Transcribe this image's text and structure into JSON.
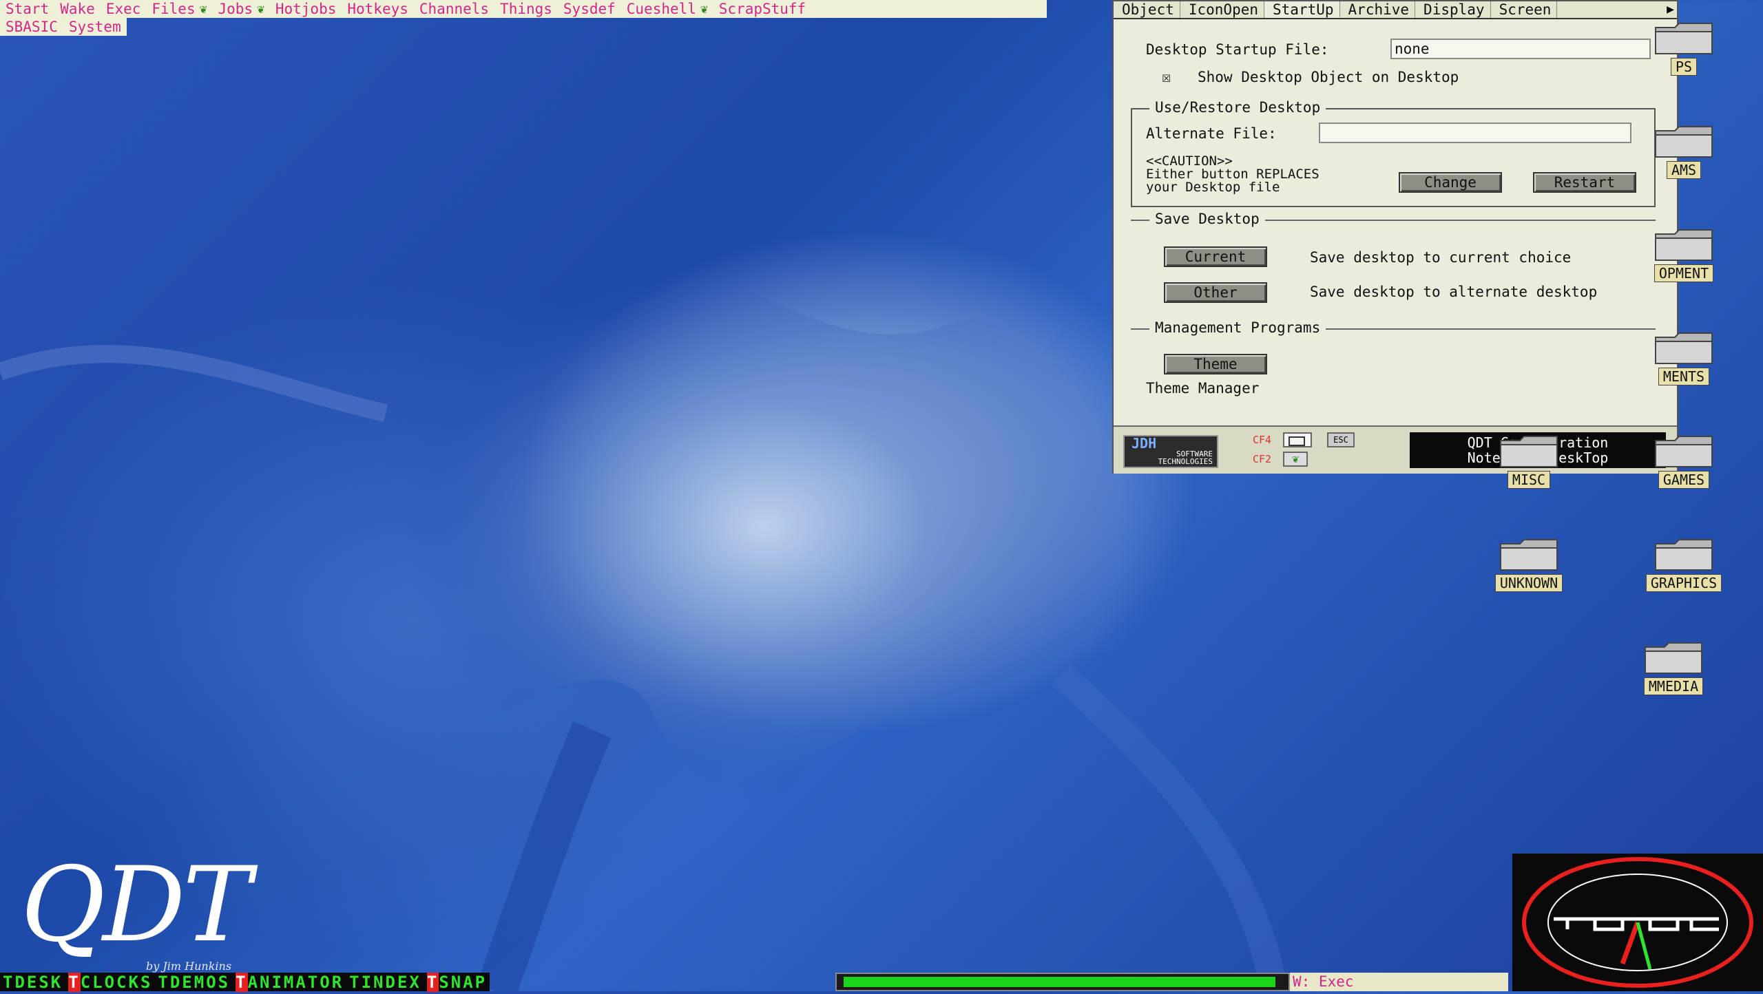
{
  "menu": {
    "row1": [
      {
        "label": "Start",
        "leaf": false
      },
      {
        "label": "Wake",
        "leaf": false
      },
      {
        "label": "Exec",
        "leaf": false
      },
      {
        "label": "Files",
        "leaf": true
      },
      {
        "label": "Jobs",
        "leaf": true
      },
      {
        "label": "Hotjobs",
        "leaf": false
      },
      {
        "label": "Hotkeys",
        "leaf": false
      },
      {
        "label": "Channels",
        "leaf": false
      },
      {
        "label": "Things",
        "leaf": false
      },
      {
        "label": "Sysdef",
        "leaf": false
      },
      {
        "label": "Cueshell",
        "leaf": true
      },
      {
        "label": "ScrapStuff",
        "leaf": false
      }
    ],
    "row2": [
      {
        "label": "SBASIC"
      },
      {
        "label": "System"
      }
    ]
  },
  "window": {
    "tabs": [
      {
        "label": "Object",
        "active": false
      },
      {
        "label": "IconOpen",
        "active": false
      },
      {
        "label": "StartUp",
        "active": true
      },
      {
        "label": "Archive",
        "active": false
      },
      {
        "label": "Display",
        "active": false
      },
      {
        "label": "Screen",
        "active": false
      }
    ],
    "startup_file_label": "Desktop Startup File:",
    "startup_file_value": "none",
    "show_object_check": "☒",
    "show_object_label": "Show Desktop Object on Desktop",
    "use_restore_title": "Use/Restore Desktop",
    "alternate_file_label": "Alternate File:",
    "alternate_file_value": "",
    "caution_1": "<<CAUTION>>",
    "caution_2": "Either button REPLACES",
    "caution_3": "your Desktop file",
    "change_btn": "Change",
    "restart_btn": "Restart",
    "save_title": "Save Desktop",
    "current_btn": "Current",
    "current_desc": "Save desktop to current choice",
    "other_btn": "Other",
    "other_desc": "Save desktop to alternate desktop",
    "mgmt_title": "Management Programs",
    "theme_btn": "Theme",
    "theme_desc": "Theme Manager",
    "logo_1": "JDH",
    "logo_2": "SOFTWARE",
    "logo_3": "TECHNOLOGIES",
    "cf4": "CF4",
    "cf2": "CF2",
    "esc_key": "ESC",
    "status_1": "QDT  Configuration",
    "status_2": "Notebook: DeskTop"
  },
  "desktop_icons": [
    {
      "label": "PS"
    },
    {
      "label": "AMS"
    },
    {
      "label": "OPMENT"
    },
    {
      "label": "MENTS"
    },
    {
      "label": "MISC"
    },
    {
      "label": "GAMES"
    },
    {
      "label": "UNKNOWN"
    },
    {
      "label": "GRAPHICS"
    },
    {
      "label": "MMEDIA"
    }
  ],
  "branding": {
    "qdt": "QDT",
    "byline": "by Jim Hunkins"
  },
  "taskbar": {
    "tasks": [
      {
        "prefix": "T",
        "label": "DESK",
        "red": false
      },
      {
        "prefix": "T",
        "label": "CLOCKS",
        "red": true
      },
      {
        "prefix": "T",
        "label": "DEMOS",
        "red": false
      },
      {
        "prefix": "T",
        "label": "ANIMATOR",
        "red": true
      },
      {
        "prefix": "T",
        "label": "INDEX",
        "red": false
      },
      {
        "prefix": "T",
        "label": "SNAP",
        "red": true
      }
    ],
    "progress": 0.98,
    "exec_label": "W: Exec"
  },
  "colors": {
    "menu_text": "#d1278b",
    "task_green": "#2fe32f",
    "progress_green": "#19d419"
  }
}
